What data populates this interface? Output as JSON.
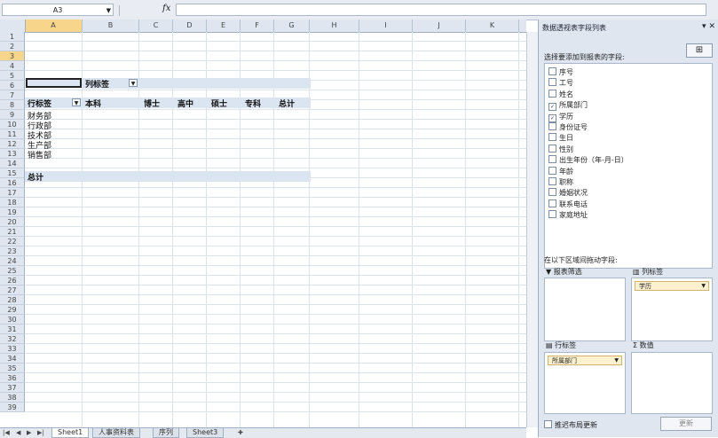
{
  "formula_bar": {
    "name_box": "A3",
    "fx": "fx",
    "formula": ""
  },
  "columns": [
    "A",
    "B",
    "C",
    "D",
    "E",
    "F",
    "G",
    "H",
    "I",
    "J",
    "K"
  ],
  "selected_column": "A",
  "rows": [
    "1",
    "2",
    "3",
    "4",
    "5",
    "6",
    "7",
    "8",
    "9",
    "10",
    "11",
    "12",
    "13",
    "14",
    "15",
    "16",
    "17",
    "18",
    "19",
    "20",
    "21",
    "22",
    "23",
    "24",
    "25",
    "26",
    "27",
    "28",
    "29",
    "30",
    "31",
    "32",
    "33",
    "34",
    "35",
    "36",
    "37",
    "38",
    "39"
  ],
  "selected_row": "3",
  "pivot": {
    "col_label_header": "列标签",
    "row_label_header": "行标签",
    "columns": [
      "本科",
      "博士",
      "高中",
      "硕士",
      "专科",
      "总计"
    ],
    "rows": [
      "财务部",
      "行政部",
      "技术部",
      "生产部",
      "销售部"
    ],
    "total_label": "总计"
  },
  "sheet_tabs": [
    "Sheet1",
    "人事资料表",
    "序列",
    "Sheet3"
  ],
  "active_tab": "Sheet1",
  "pane": {
    "title": "数据透视表字段列表",
    "choose_fields_label": "选择要添加到报表的字段:",
    "fields": [
      {
        "label": "序号",
        "checked": false
      },
      {
        "label": "工号",
        "checked": false
      },
      {
        "label": "姓名",
        "checked": false
      },
      {
        "label": "所属部门",
        "checked": true
      },
      {
        "label": "学历",
        "checked": true
      },
      {
        "label": "身份证号",
        "checked": false
      },
      {
        "label": "生日",
        "checked": false
      },
      {
        "label": "性别",
        "checked": false
      },
      {
        "label": "出生年份（年-月-日）",
        "checked": false
      },
      {
        "label": "年龄",
        "checked": false
      },
      {
        "label": "职称",
        "checked": false
      },
      {
        "label": "婚姻状况",
        "checked": false
      },
      {
        "label": "联系电话",
        "checked": false
      },
      {
        "label": "家庭地址",
        "checked": false
      }
    ],
    "areas_label": "在以下区域间拖动字段:",
    "filter_label": "报表筛选",
    "column_label": "列标签",
    "row_label": "行标签",
    "values_label": "数值",
    "column_chip": "学历",
    "row_chip": "所属部门",
    "defer_label": "推迟布局更新",
    "update_label": "更新"
  }
}
